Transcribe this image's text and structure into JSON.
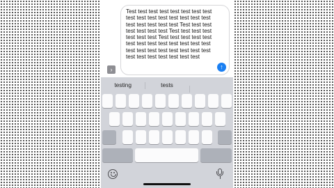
{
  "composer": {
    "message_text": "Test test test test test test test test test test test test test test test test test test test test test Test test test test test test test Test test test test test test test Test test test test test test test test test test test test test test test test test test test test test test test test test test test test",
    "expand_icon": "chevron-right-icon",
    "send_icon": "arrow-up-icon"
  },
  "keyboard": {
    "suggestions": [
      "testing",
      "tests",
      ""
    ],
    "bottom_left_icon": "emoji-icon",
    "bottom_right_icon": "microphone-icon"
  },
  "colors": {
    "send_button": "#1a7ff2",
    "keyboard_background": "#d2d4da",
    "key_background": "#fbfbfc",
    "special_key_background": "#adb1b9"
  }
}
